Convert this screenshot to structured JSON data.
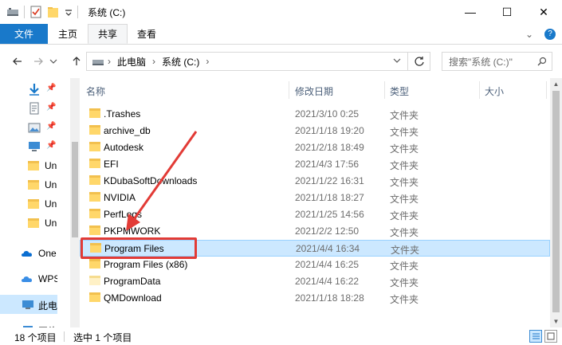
{
  "window": {
    "title": "系统 (C:)",
    "minimize_glyph": "—",
    "maximize_glyph": "☐",
    "close_glyph": "✕"
  },
  "ribbon": {
    "tabs": [
      {
        "label": "文件"
      },
      {
        "label": "主页"
      },
      {
        "label": "共享"
      },
      {
        "label": "查看"
      }
    ],
    "expand_glyph": "⌄",
    "help_glyph": "?"
  },
  "address": {
    "crumbs": [
      "此电脑",
      "系统 (C:)"
    ],
    "search_placeholder": "搜索\"系统 (C:)\""
  },
  "nav_pane": {
    "items": [
      {
        "label": "",
        "icon": "download-icon",
        "pinned": true
      },
      {
        "label": "",
        "icon": "document-icon",
        "pinned": true
      },
      {
        "label": "",
        "icon": "picture-icon",
        "pinned": true
      },
      {
        "label": "",
        "icon": "desktop-icon",
        "pinned": true
      },
      {
        "label": "Un",
        "icon": "folder-icon",
        "pinned": false
      },
      {
        "label": "Un",
        "icon": "folder-icon",
        "pinned": false
      },
      {
        "label": "Un",
        "icon": "folder-icon",
        "pinned": false
      },
      {
        "label": "Un",
        "icon": "folder-icon",
        "pinned": false
      },
      {
        "label": "",
        "icon": "",
        "pinned": false
      },
      {
        "label": "One",
        "icon": "onedrive-cloud-icon",
        "pinned": false
      },
      {
        "label": "WPS",
        "icon": "wps-cloud-icon",
        "pinned": false
      },
      {
        "label": "此电",
        "icon": "this-pc-icon",
        "pinned": false,
        "selected": true
      },
      {
        "label": "网络",
        "icon": "network-icon",
        "pinned": false
      }
    ]
  },
  "file_list": {
    "columns": {
      "name": "名称",
      "date": "修改日期",
      "type": "类型",
      "size": "大小"
    },
    "rows": [
      {
        "name": ".Trashes",
        "date": "2021/3/10 0:25",
        "type": "文件夹"
      },
      {
        "name": "archive_db",
        "date": "2021/1/18 19:20",
        "type": "文件夹"
      },
      {
        "name": "Autodesk",
        "date": "2021/2/18 18:49",
        "type": "文件夹"
      },
      {
        "name": "EFI",
        "date": "2021/4/3 17:56",
        "type": "文件夹"
      },
      {
        "name": "KDubaSoftDownloads",
        "date": "2021/1/22 16:31",
        "type": "文件夹"
      },
      {
        "name": "NVIDIA",
        "date": "2021/1/18 18:27",
        "type": "文件夹"
      },
      {
        "name": "PerfLogs",
        "date": "2021/1/25 14:56",
        "type": "文件夹"
      },
      {
        "name": "PKPMWORK",
        "date": "2021/2/2 12:50",
        "type": "文件夹"
      },
      {
        "name": "Program Files",
        "date": "2021/4/4 16:34",
        "type": "文件夹",
        "selected": true
      },
      {
        "name": "Program Files (x86)",
        "date": "2021/4/4 16:25",
        "type": "文件夹"
      },
      {
        "name": "ProgramData",
        "date": "2021/4/4 16:22",
        "type": "文件夹",
        "light": true
      },
      {
        "name": "QMDownload",
        "date": "2021/1/18 18:28",
        "type": "文件夹"
      }
    ]
  },
  "status": {
    "item_count": "18 个项目",
    "selected_count": "选中 1 个项目"
  },
  "colors": {
    "accent": "#1979ca",
    "selection": "#cce8ff",
    "annotation": "#e23b36"
  }
}
